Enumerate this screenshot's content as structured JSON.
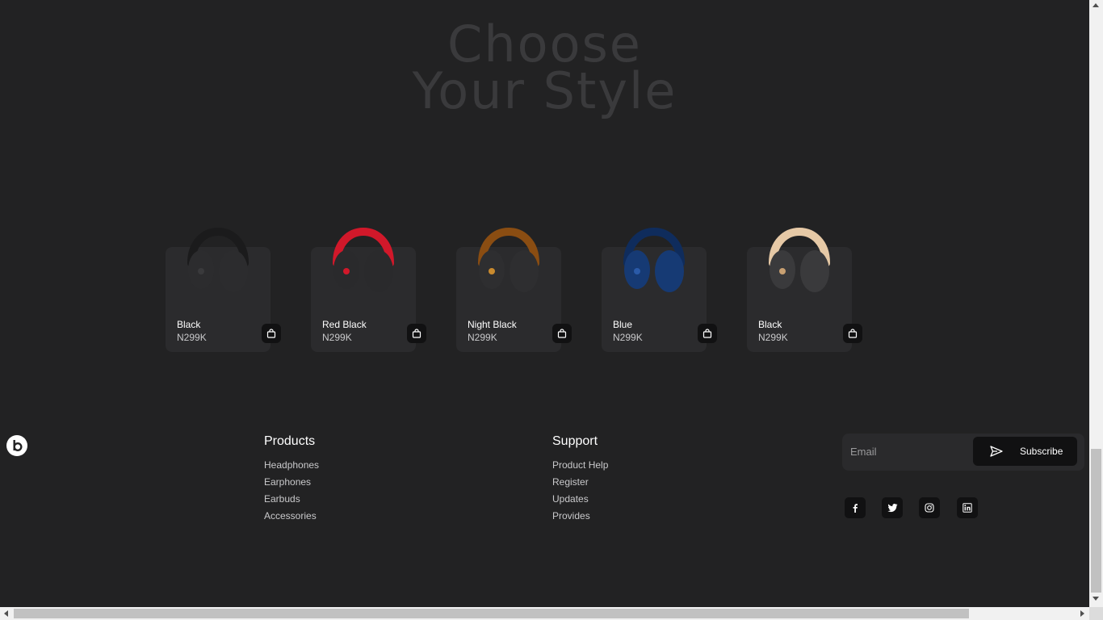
{
  "heading": {
    "line1": "Choose",
    "line2": "Your Style"
  },
  "products": [
    {
      "name": "Black",
      "price": "N299K",
      "band": "#1b1b1c",
      "cup": "#2c2c2e",
      "accent": "#3a3a3c",
      "icon": "headphones-icon"
    },
    {
      "name": "Red Black",
      "price": "N299K",
      "band": "#d1182a",
      "cup": "#2a2a2c",
      "accent": "#d1182a",
      "icon": "headphones-icon"
    },
    {
      "name": "Night Black",
      "price": "N299K",
      "band": "#8a4d12",
      "cup": "#2e2e30",
      "accent": "#c98a2e",
      "icon": "headphones-icon"
    },
    {
      "name": "Blue",
      "price": "N299K",
      "band": "#0f2c5c",
      "cup": "#163a74",
      "accent": "#2a5aa8",
      "icon": "headphones-icon"
    },
    {
      "name": "Black",
      "price": "N299K",
      "band": "#e6c9a6",
      "cup": "#3a3a3c",
      "accent": "#c8a072",
      "icon": "headphones-icon"
    }
  ],
  "footer": {
    "logo_icon": "beats-logo-icon",
    "products": {
      "title": "Products",
      "links": [
        "Headphones",
        "Earphones",
        "Earbuds",
        "Accessories"
      ]
    },
    "support": {
      "title": "Support",
      "links": [
        "Product Help",
        "Register",
        "Updates",
        "Provides"
      ]
    },
    "subscribe": {
      "placeholder": "Email",
      "button_label": "Subscribe",
      "button_icon": "send-icon"
    },
    "social": [
      "facebook-icon",
      "twitter-icon",
      "instagram-icon",
      "linkedin-icon"
    ]
  },
  "colors": {
    "background": "#222223",
    "card": "#2b2b2d",
    "heading": "#3a3a3c",
    "button": "#111112"
  }
}
